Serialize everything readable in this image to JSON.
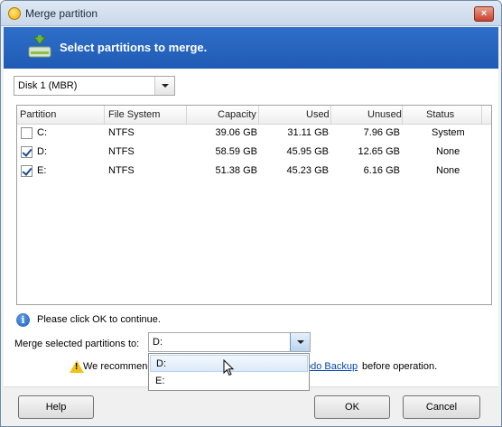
{
  "window": {
    "title": "Merge partition",
    "close_label": "×"
  },
  "banner": {
    "text": "Select partitions to merge.",
    "icon": "merge-partition-icon"
  },
  "disk_select": {
    "value": "Disk 1 (MBR)"
  },
  "table": {
    "headers": [
      "Partition",
      "File System",
      "Capacity",
      "Used",
      "Unused",
      "Status"
    ],
    "rows": [
      {
        "checked": false,
        "partition": "C:",
        "fs": "NTFS",
        "capacity": "39.06 GB",
        "used": "31.11 GB",
        "unused": "7.96 GB",
        "status": "System"
      },
      {
        "checked": true,
        "partition": "D:",
        "fs": "NTFS",
        "capacity": "58.59 GB",
        "used": "45.95 GB",
        "unused": "12.65 GB",
        "status": "None"
      },
      {
        "checked": true,
        "partition": "E:",
        "fs": "NTFS",
        "capacity": "51.38 GB",
        "used": "45.23 GB",
        "unused": "6.16 GB",
        "status": "None"
      }
    ]
  },
  "info": {
    "text": "Please click OK to continue."
  },
  "merge_target": {
    "label": "Merge selected partitions to:",
    "value": "D:",
    "options": [
      "D:",
      "E:"
    ],
    "highlighted": "D:"
  },
  "warning": {
    "text_before": "We recommend",
    "link_text": "odo Backup",
    "text_after": "before operation."
  },
  "buttons": {
    "help": "Help",
    "ok": "OK",
    "cancel": "Cancel"
  }
}
